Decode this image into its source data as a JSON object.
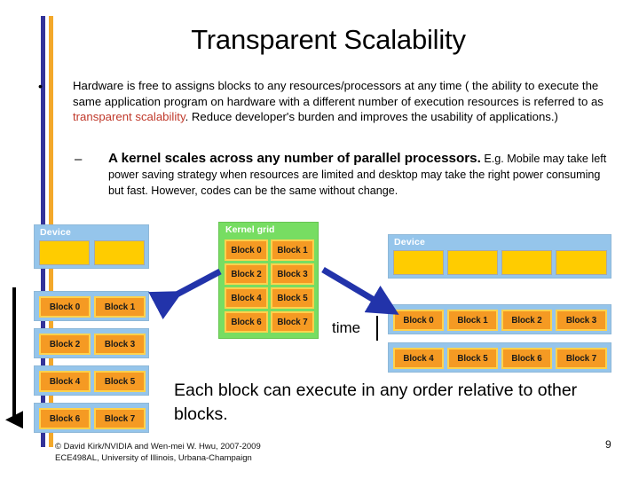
{
  "slide": {
    "title": "Transparent Scalability",
    "page_number": "9",
    "accent_blue": "#333399",
    "accent_orange": "#F3A82A",
    "highlight_color": "#C0392B",
    "device_panel_color": "#95C5EB",
    "slot_color": "#FFCC00",
    "block_color": "#F59A23",
    "kernel_grid_color": "#77DD62",
    "arrow_color": "#2233AA"
  },
  "bullets": {
    "level1_marker": "•",
    "level1_part1": "Hardware is free to assigns blocks to any resources/processors at any time ( the ability to execute the same application program on hardware with a different number of execution resources is referred to as ",
    "level1_highlight": "transparent scalability",
    "level1_part2": ". Reduce developer's burden and improves the usability of applications.)",
    "level2_marker": "–",
    "level2_lead": "A kernel scales across any number of parallel processors.",
    "level2_rest": " E.g. Mobile may take left power saving strategy when resources are limited and desktop may take the right power consuming but fast. However, codes can be the same without change."
  },
  "diagram": {
    "left_device": {
      "label": "Device",
      "slots": [
        "",
        ""
      ],
      "rows": [
        [
          "Block 0",
          "Block 1"
        ],
        [
          "Block 2",
          "Block 3"
        ],
        [
          "Block 4",
          "Block 5"
        ],
        [
          "Block 6",
          "Block 7"
        ]
      ]
    },
    "kernel_grid": {
      "label": "Kernel grid",
      "rows": [
        [
          "Block 0",
          "Block 1"
        ],
        [
          "Block 2",
          "Block 3"
        ],
        [
          "Block 4",
          "Block 5"
        ],
        [
          "Block 6",
          "Block 7"
        ]
      ]
    },
    "right_device": {
      "label": "Device",
      "slots": [
        "",
        "",
        "",
        ""
      ],
      "rows": [
        [
          "Block 0",
          "Block 1",
          "Block 2",
          "Block 3"
        ],
        [
          "Block 4",
          "Block 5",
          "Block 6",
          "Block 7"
        ]
      ]
    },
    "time_label": "time"
  },
  "callout": "Each block can execute in any order relative to other blocks.",
  "footer": {
    "line1": "© David Kirk/NVIDIA and Wen-mei W. Hwu, 2007-2009",
    "line2": "ECE498AL, University of Illinois, Urbana-Champaign"
  }
}
